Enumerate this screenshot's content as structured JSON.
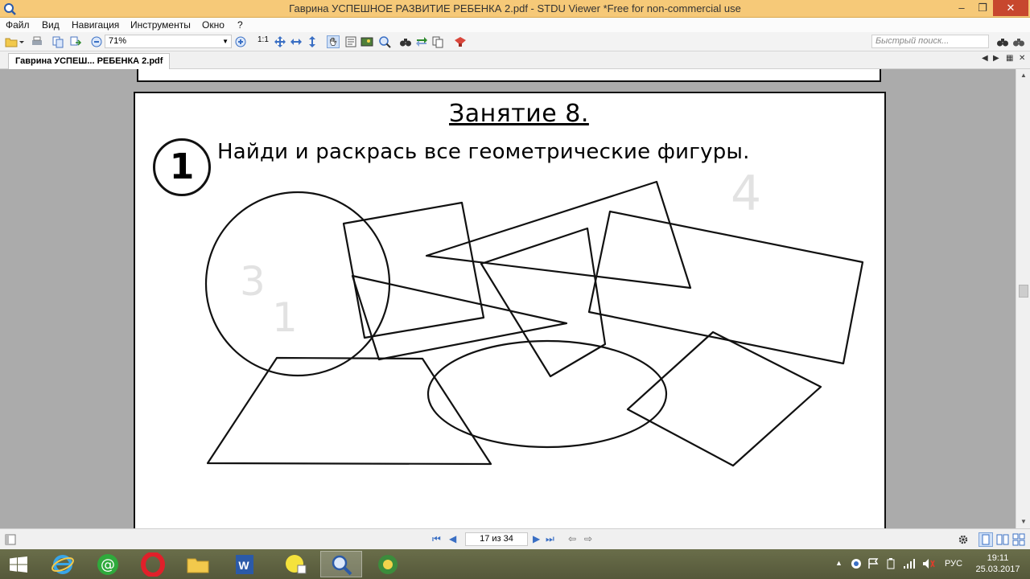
{
  "window": {
    "title": "Гаврина УСПЕШНОЕ РАЗВИТИЕ РЕБЕНКА 2.pdf - STDU Viewer *Free for non-commercial use",
    "buttons": {
      "minimize": "–",
      "maximize": "❐",
      "close": "✕"
    }
  },
  "menu": [
    "Файл",
    "Вид",
    "Навигация",
    "Инструменты",
    "Окно",
    "?"
  ],
  "toolbar": {
    "zoom_value": "71%",
    "fit_label": "1:1",
    "search_placeholder": "Быстрый поиск..."
  },
  "tabs": [
    {
      "label": "Гаврина УСПЕШ... РЕБЕНКА 2.pdf",
      "active": true
    }
  ],
  "document": {
    "lesson_title": "Занятие 8.",
    "task_number": "1",
    "task_text": "Найди и раскрась все геометрические фигуры."
  },
  "statusbar": {
    "page_indicator": "17 из 34"
  },
  "taskbar": {
    "apps": [
      "internet-explorer",
      "mail-agent",
      "opera",
      "file-explorer",
      "word",
      "snip-tool",
      "stdu-viewer",
      "app-shield"
    ],
    "language": "РУС",
    "time": "19:11",
    "date": "25.03.2017"
  },
  "colors": {
    "titlebar": "#f6c978",
    "close_button": "#c7472e",
    "viewer_background": "#ababab",
    "taskbar": "#5f6342"
  }
}
